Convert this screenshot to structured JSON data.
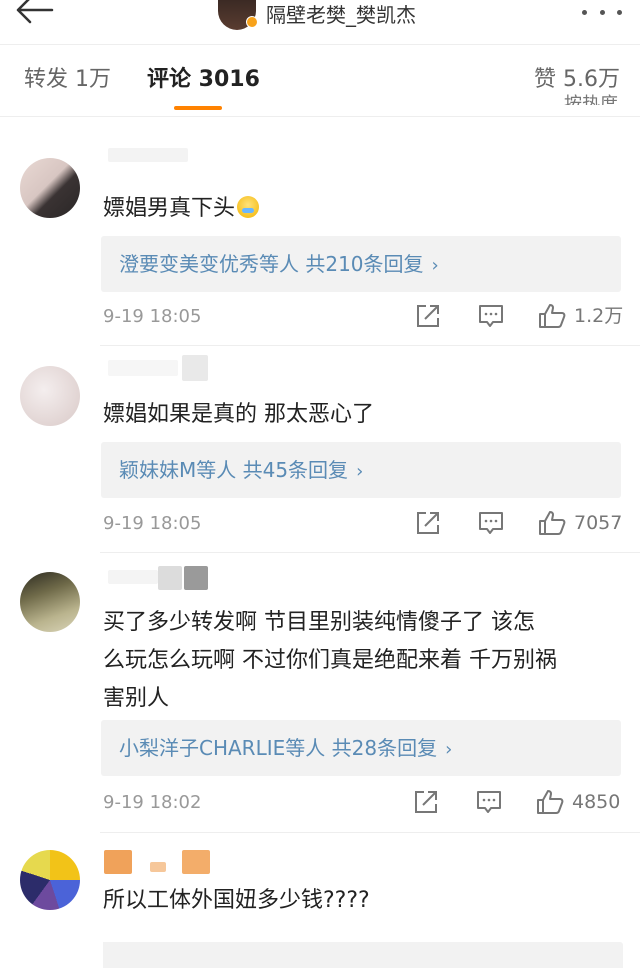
{
  "header": {
    "username": "隔壁老樊_樊凯杰"
  },
  "tabs": {
    "forward_label": "转发 1万",
    "comment_label": "评论 3016",
    "like_label": "赞 5.6万"
  },
  "sort_label": "按热度",
  "comments": [
    {
      "text": "嫖娼男真下头",
      "replies": "澄要变美变优秀等人  共210条回复",
      "time": "9-19 18:05",
      "likes": "1.2万"
    },
    {
      "text": "嫖娼如果是真的 那太恶心了",
      "replies": "颖妹妹M等人  共45条回复",
      "time": "9-19 18:05",
      "likes": "7057"
    },
    {
      "text_lines": [
        "买了多少转发啊   节目里别装纯情傻子了   该怎",
        "么玩怎么玩啊   不过你们真是绝配来着  千万别祸",
        "害别人"
      ],
      "replies": "小梨洋子CHARLIE等人  共28条回复",
      "time": "9-19 18:02",
      "likes": "4850"
    },
    {
      "text": "所以工体外国妞多少钱????"
    }
  ],
  "icons": {
    "back": "back-arrow-icon",
    "more": "more-dots-icon",
    "forward": "share-icon",
    "comment": "comment-icon",
    "like": "thumbs-up-icon",
    "reply_chevron": "chevron-right-icon"
  },
  "colors": {
    "accent": "#ff8200",
    "reply_link": "#5a8bb5",
    "meta": "#999999",
    "reply_bg": "#f2f2f2"
  }
}
